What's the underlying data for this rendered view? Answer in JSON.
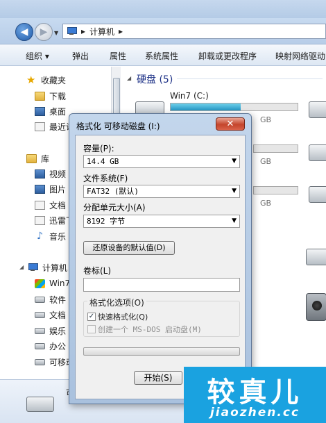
{
  "explorer": {
    "address": {
      "separator": "▸",
      "location": "计算机",
      "trail": "▸"
    },
    "toolbar": [
      "组织 ▾",
      "弹出",
      "属性",
      "系统属性",
      "卸载或更改程序",
      "映射网络驱动"
    ],
    "nav": {
      "favorites": {
        "label": "收藏夹",
        "items": [
          "下载",
          "桌面",
          "最近访"
        ]
      },
      "library": {
        "label": "库",
        "items": [
          "视频",
          "图片",
          "文档",
          "迅雷下",
          "音乐"
        ]
      },
      "computer": {
        "label": "计算机",
        "items": [
          "Win7",
          "软件",
          "文档",
          "娱乐",
          "办公",
          "可移动"
        ]
      }
    },
    "content": {
      "group_title": "硬盘 (5)",
      "drive_c": {
        "name": "Win7 (C:)",
        "used_fraction": 0.55
      },
      "size_fragments": [
        "GB",
        "GB",
        "GB"
      ]
    },
    "details_text": "可"
  },
  "dialog": {
    "title": "格式化 可移动磁盘 (I:)",
    "close_glyph": "✕",
    "capacity_label": "容量(P):",
    "capacity_value": "14.4 GB",
    "filesystem_label": "文件系统(F)",
    "filesystem_value": "FAT32 (默认)",
    "alloc_label": "分配单元大小(A)",
    "alloc_value": "8192 字节",
    "restore_button": "还原设备的默认值(D)",
    "volume_label": "卷标(L)",
    "volume_value": "",
    "options_label": "格式化选项(O)",
    "quick_format": {
      "label": "快速格式化(Q)",
      "checked": true
    },
    "msdos_boot": {
      "label": "创建一个 MS-DOS 启动盘(M)",
      "checked": false
    },
    "progress": 0,
    "start_button": "开始(S)",
    "dropdown_glyph": "▼"
  },
  "watermark": {
    "main": "较真儿",
    "site": "jiaozhen.cc"
  },
  "colors": {
    "accent": "#1aa2e0",
    "close_red": "#c4452c",
    "drive_bar": "#2596c4"
  }
}
